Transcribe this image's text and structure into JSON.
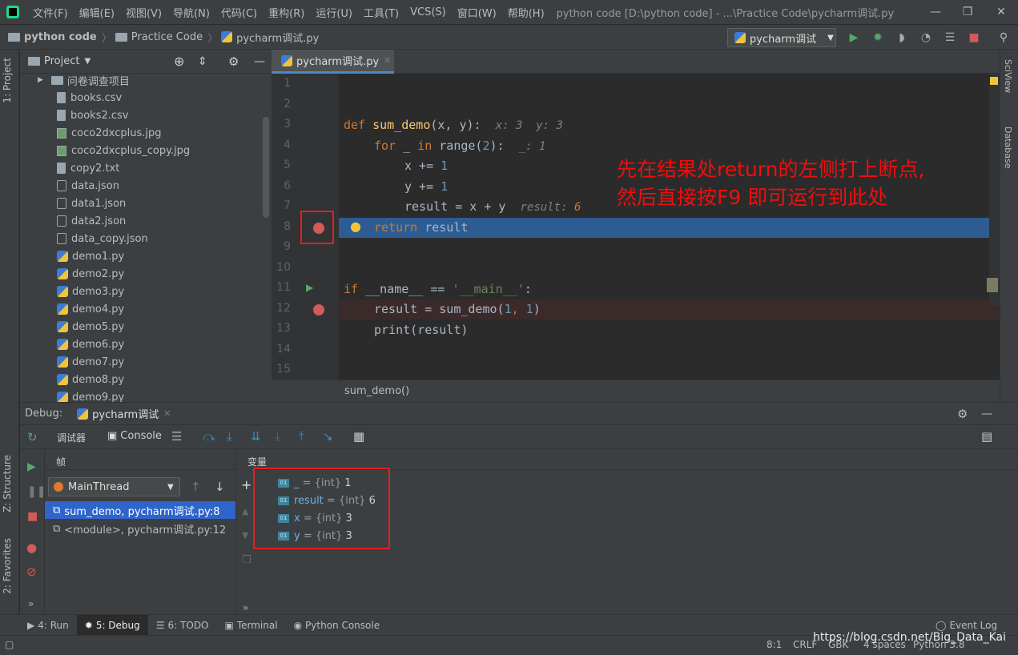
{
  "menubar": {
    "items": [
      "文件(F)",
      "编辑(E)",
      "视图(V)",
      "导航(N)",
      "代码(C)",
      "重构(R)",
      "运行(U)",
      "工具(T)",
      "VCS(S)",
      "窗口(W)",
      "帮助(H)"
    ],
    "window_title": "python code [D:\\python code] - ...\\Practice Code\\pycharm调试.py"
  },
  "navbar": {
    "crumbs": [
      "python code",
      "Practice Code",
      "pycharm调试.py"
    ],
    "run_config": "pycharm调试"
  },
  "left_strip": {
    "project_tab": "1: Project",
    "structure_tab": "Z: Structure",
    "favorites_tab": "2: Favorites"
  },
  "right_strip": {
    "sciview_tab": "SciView",
    "database_tab": "Database"
  },
  "project": {
    "title": "Project",
    "items": [
      {
        "name": "问卷调查项目",
        "kind": "folder"
      },
      {
        "name": "books.csv",
        "kind": "file"
      },
      {
        "name": "books2.csv",
        "kind": "file"
      },
      {
        "name": "coco2dxcplus.jpg",
        "kind": "image"
      },
      {
        "name": "coco2dxcplus_copy.jpg",
        "kind": "image"
      },
      {
        "name": "copy2.txt",
        "kind": "file"
      },
      {
        "name": "data.json",
        "kind": "json"
      },
      {
        "name": "data1.json",
        "kind": "json"
      },
      {
        "name": "data2.json",
        "kind": "json"
      },
      {
        "name": "data_copy.json",
        "kind": "json"
      },
      {
        "name": "demo1.py",
        "kind": "py"
      },
      {
        "name": "demo2.py",
        "kind": "py"
      },
      {
        "name": "demo3.py",
        "kind": "py"
      },
      {
        "name": "demo4.py",
        "kind": "py"
      },
      {
        "name": "demo5.py",
        "kind": "py"
      },
      {
        "name": "demo6.py",
        "kind": "py"
      },
      {
        "name": "demo7.py",
        "kind": "py"
      },
      {
        "name": "demo8.py",
        "kind": "py"
      },
      {
        "name": "demo9.py",
        "kind": "py"
      }
    ]
  },
  "editor": {
    "tab_label": "pycharm调试.py",
    "line_numbers": [
      "1",
      "2",
      "3",
      "4",
      "5",
      "6",
      "7",
      "8",
      "9",
      "10",
      "11",
      "12",
      "13",
      "14",
      "15"
    ],
    "code": {
      "l3_def": "def ",
      "l3_fn": "sum_demo",
      "l3_rest": "(x, y):",
      "l3_hint": "x: 3  y: 3",
      "l4_for": "for",
      "l4_mid": " _ ",
      "l4_in": "in",
      "l4_range": " range(",
      "l4_num": "2",
      "l4_end": "):",
      "l4_hint": "_: 1",
      "l5_a": "x += ",
      "l5_num": "1",
      "l6_a": "y += ",
      "l6_num": "1",
      "l7_a": "result = x + y",
      "l7_hint_label": "result: ",
      "l7_hint_val": "6",
      "l8_kw": "return",
      "l8_rest": " result",
      "l11_if": "if",
      "l11_name": " __name__ ",
      "l11_eq": "== ",
      "l11_str": "'__main__'",
      "l11_colon": ":",
      "l12_a": "result = sum_demo(",
      "l12_n1": "1",
      "l12_comma": ", ",
      "l12_n2": "1",
      "l12_end": ")",
      "l13_a": "print(result)"
    },
    "breadcrumb": "sum_demo()"
  },
  "annotation": {
    "line1": "先在结果处return的左侧打上断点,",
    "line2": "然后直接按F9 即可运行到此处"
  },
  "debug": {
    "label": "Debug:",
    "session_tab": "pycharm调试",
    "debugger_tab": "调试器",
    "console_tab": "Console",
    "frames_title": "帧",
    "vars_title": "变量",
    "thread": "MainThread",
    "frames": [
      "sum_demo, pycharm调试.py:8",
      "<module>, pycharm调试.py:12"
    ],
    "variables": [
      {
        "badge": "01",
        "name": "_",
        "type": " = {int} ",
        "value": "1"
      },
      {
        "badge": "01",
        "name": "result",
        "type": " = {int} ",
        "value": "6"
      },
      {
        "badge": "01",
        "name": "x",
        "type": " = {int} ",
        "value": "3"
      },
      {
        "badge": "01",
        "name": "y",
        "type": " = {int} ",
        "value": "3"
      }
    ]
  },
  "bottom_tabs": {
    "run": "4: Run",
    "debug": "5: Debug",
    "todo": "6: TODO",
    "terminal": "Terminal",
    "python_console": "Python Console",
    "event_log": "Event Log"
  },
  "status": {
    "position": "8:1",
    "line_sep": "CRLF",
    "encoding": "GBK",
    "indent": "4 spaces",
    "interpreter": "Python 3.8"
  },
  "watermark": "https://blog.csdn.net/Big_Data_Kai"
}
